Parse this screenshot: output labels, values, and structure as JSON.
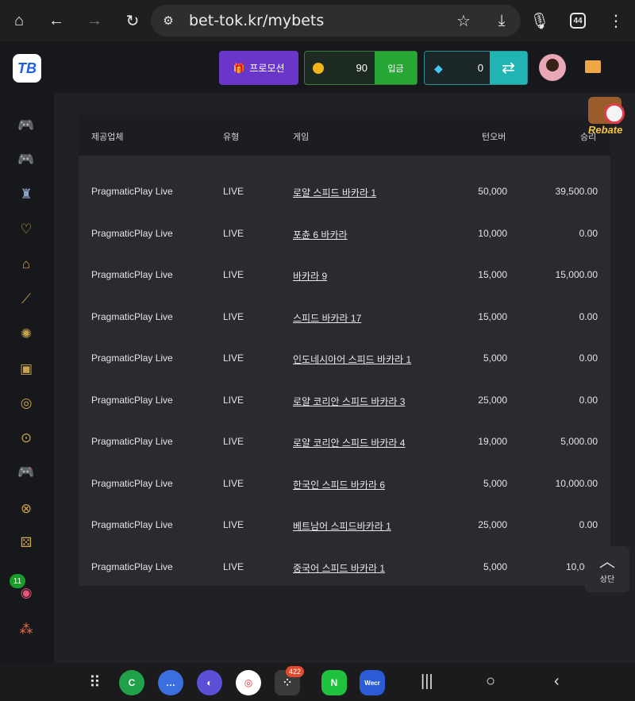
{
  "browser": {
    "url": "bet-tok.kr/mybets",
    "tab_count": "44"
  },
  "header": {
    "logo_text": "TB",
    "promo_label": "프로모션",
    "balance": "90",
    "deposit_label": "입금",
    "gem_balance": "0"
  },
  "table": {
    "columns": [
      "제공업체",
      "유형",
      "게임",
      "턴오버",
      "승리"
    ],
    "rows": [
      {
        "provider": "PragmaticPlay Live",
        "type": "LIVE",
        "game": "로얄 스피드 바카라 1",
        "turnover": "50,000",
        "win": "39,500.00"
      },
      {
        "provider": "PragmaticPlay Live",
        "type": "LIVE",
        "game": "포츈 6 바카라",
        "turnover": "10,000",
        "win": "0.00"
      },
      {
        "provider": "PragmaticPlay Live",
        "type": "LIVE",
        "game": "바카라 9",
        "turnover": "15,000",
        "win": "15,000.00"
      },
      {
        "provider": "PragmaticPlay Live",
        "type": "LIVE",
        "game": "스피드 바카라 17",
        "turnover": "15,000",
        "win": "0.00"
      },
      {
        "provider": "PragmaticPlay Live",
        "type": "LIVE",
        "game": "인도네시아어 스피드 바카라 1",
        "turnover": "5,000",
        "win": "0.00"
      },
      {
        "provider": "PragmaticPlay Live",
        "type": "LIVE",
        "game": "로얄 코리안 스피드 바카라 3",
        "turnover": "25,000",
        "win": "0.00"
      },
      {
        "provider": "PragmaticPlay Live",
        "type": "LIVE",
        "game": "로얄 코리안 스피드 바카라 4",
        "turnover": "19,000",
        "win": "5,000.00"
      },
      {
        "provider": "PragmaticPlay Live",
        "type": "LIVE",
        "game": "한국인 스피드 바카라 6",
        "turnover": "5,000",
        "win": "10,000.00"
      },
      {
        "provider": "PragmaticPlay Live",
        "type": "LIVE",
        "game": "베트남어 스피드바카라 1",
        "turnover": "25,000",
        "win": "0.00"
      },
      {
        "provider": "PragmaticPlay Live",
        "type": "LIVE",
        "game": "중국어 스피드 바카라 1",
        "turnover": "5,000",
        "win": "10,000."
      }
    ]
  },
  "rebate_label": "Rebate",
  "back_to_top_label": "상단",
  "sidebar_badge": "11",
  "dock": {
    "badge": "422",
    "naver": "N",
    "wecr": "Wecr"
  }
}
